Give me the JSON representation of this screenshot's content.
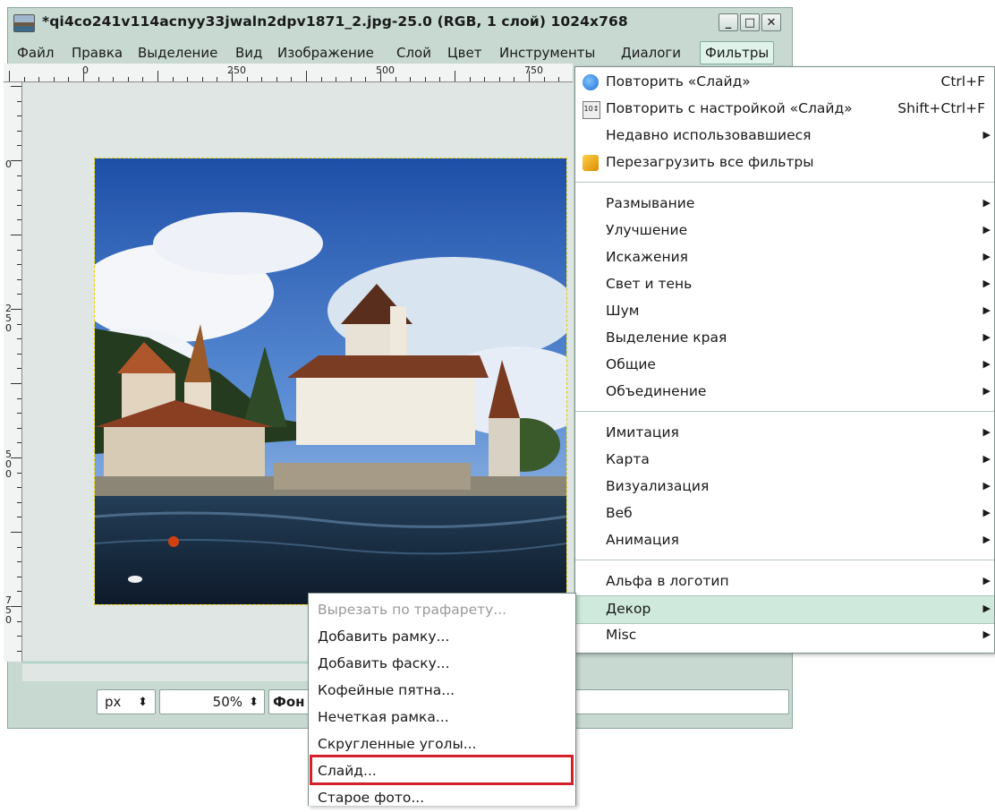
{
  "window": {
    "title": "*qi4co241v114acnyy33jwaln2dpv1871_2.jpg-25.0 (RGB, 1 слой) 1024x768",
    "controls": {
      "minimize": "_",
      "maximize": "□",
      "close": "✕"
    }
  },
  "menubar": {
    "items": [
      "Файл",
      "Правка",
      "Выделение",
      "Вид",
      "Изображение",
      "Слой",
      "Цвет",
      "Инструменты",
      "Диалоги",
      "Фильтры"
    ]
  },
  "rulers": {
    "h_labels": [
      "0",
      "250",
      "500",
      "750"
    ],
    "v_labels": [
      "0",
      "250",
      "500",
      "750"
    ]
  },
  "statusbar": {
    "unit": "px",
    "zoom": "50%",
    "layer": "Фон"
  },
  "filters_menu": {
    "items": [
      {
        "label": "Повторить «Слайд»",
        "accel": "Ctrl+F",
        "icon": "repeat-icon"
      },
      {
        "label": "Повторить с настройкой «Слайд»",
        "accel": "Shift+Ctrl+F",
        "icon": "reshow-icon"
      },
      {
        "label": "Недавно использовавшиеся",
        "submenu": true
      },
      {
        "label": "Перезагрузить все фильтры",
        "icon": "reload-icon"
      },
      {
        "label": "Размывание",
        "submenu": true
      },
      {
        "label": "Улучшение",
        "submenu": true
      },
      {
        "label": "Искажения",
        "submenu": true
      },
      {
        "label": "Свет и тень",
        "submenu": true
      },
      {
        "label": "Шум",
        "submenu": true
      },
      {
        "label": "Выделение края",
        "submenu": true
      },
      {
        "label": "Общие",
        "submenu": true
      },
      {
        "label": "Объединение",
        "submenu": true
      },
      {
        "label": "Имитация",
        "submenu": true
      },
      {
        "label": "Карта",
        "submenu": true
      },
      {
        "label": "Визуализация",
        "submenu": true
      },
      {
        "label": "Веб",
        "submenu": true
      },
      {
        "label": "Анимация",
        "submenu": true
      },
      {
        "label": "Альфа в логотип",
        "submenu": true
      },
      {
        "label": "Декор",
        "submenu": true,
        "highlighted": true
      },
      {
        "label": "Misc",
        "submenu": true
      }
    ]
  },
  "decor_submenu": {
    "items": [
      {
        "label": "Вырезать по трафарету...",
        "disabled": true
      },
      {
        "label": "Добавить рамку..."
      },
      {
        "label": "Добавить фаску..."
      },
      {
        "label": "Кофейные пятна..."
      },
      {
        "label": "Нечеткая рамка..."
      },
      {
        "label": "Скругленные уголы..."
      },
      {
        "label": "Слайд...",
        "outlined": true
      },
      {
        "label": "Старое фото..."
      }
    ]
  },
  "colors": {
    "highlight": "#cfe9dc",
    "outline": "#d4202a",
    "window_bg": "#c7d9d1"
  }
}
